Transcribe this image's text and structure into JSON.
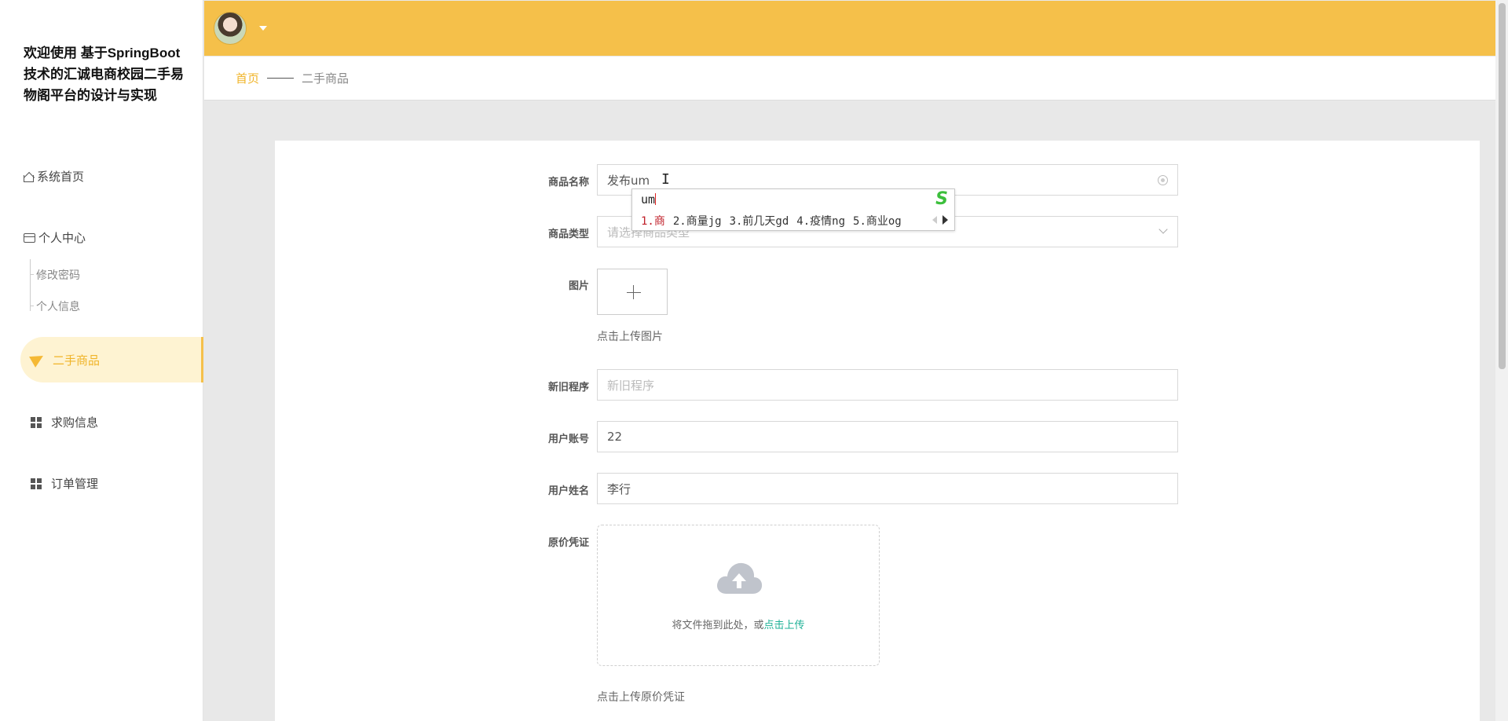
{
  "sidebar": {
    "title": "欢迎使用 基于SpringBoot技术的汇诚电商校园二手易物阁平台的设计与实现",
    "items": [
      {
        "label": "系统首页"
      },
      {
        "label": "个人中心"
      },
      {
        "label": "修改密码"
      },
      {
        "label": "个人信息"
      },
      {
        "label": "二手商品"
      },
      {
        "label": "求购信息"
      },
      {
        "label": "订单管理"
      }
    ],
    "active_color": "#f0b429"
  },
  "header": {
    "accent": "#f5c04a"
  },
  "breadcrumb": {
    "home": "首页",
    "current": "二手商品"
  },
  "form": {
    "name": {
      "label": "商品名称",
      "value": "发布um"
    },
    "type": {
      "label": "商品类型",
      "placeholder": "请选择商品类型"
    },
    "image": {
      "label": "图片",
      "hint": "点击上传图片"
    },
    "condition": {
      "label": "新旧程序",
      "placeholder": "新旧程序"
    },
    "account": {
      "label": "用户账号",
      "value": "22"
    },
    "username": {
      "label": "用户姓名",
      "value": "李行"
    },
    "proof": {
      "label": "原价凭证",
      "drop_text": "将文件拖到此处，或",
      "drop_link": "点击上传",
      "hint": "点击上传原价凭证"
    }
  },
  "ime": {
    "composition": "um",
    "candidates": [
      "1.商",
      "2.商量jg",
      "3.前几天gd",
      "4.疫情ng",
      "5.商业og"
    ],
    "logo": "S"
  }
}
